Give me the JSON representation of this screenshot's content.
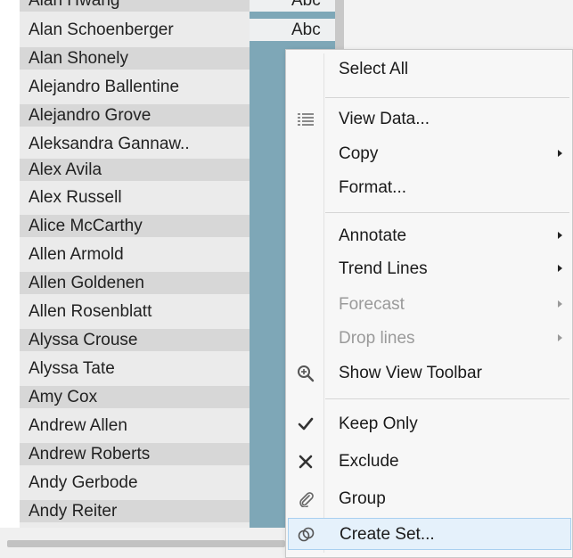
{
  "list": {
    "top_partial": "Alan Hwang",
    "names": [
      "Alan Schoenberger",
      "Alan Shonely",
      "Alejandro Ballentine",
      "Alejandro Grove",
      "Aleksandra Gannaw..",
      "Alex Avila",
      "Alex Russell",
      "Alice McCarthy",
      "Allen Armold",
      "Allen Goldenen",
      "Allen Rosenblatt",
      "Alyssa Crouse",
      "Alyssa Tate",
      "Amy Cox",
      "Andrew Allen",
      "Andrew Roberts",
      "Andy Gerbode",
      "Andy Reiter"
    ],
    "abc_top_partial": "Abc",
    "abc_value": "Abc"
  },
  "menu": {
    "items": [
      {
        "label": "Select All",
        "icon": "",
        "submenu": false,
        "disabled": false
      },
      {
        "label": "View Data...",
        "icon": "grid-icon",
        "submenu": false,
        "disabled": false
      },
      {
        "label": "Copy",
        "icon": "",
        "submenu": true,
        "disabled": false
      },
      {
        "label": "Format...",
        "icon": "",
        "submenu": false,
        "disabled": false
      },
      {
        "label": "Annotate",
        "icon": "",
        "submenu": true,
        "disabled": false
      },
      {
        "label": "Trend Lines",
        "icon": "",
        "submenu": true,
        "disabled": false
      },
      {
        "label": "Forecast",
        "icon": "",
        "submenu": true,
        "disabled": true
      },
      {
        "label": "Drop lines",
        "icon": "",
        "submenu": true,
        "disabled": true
      },
      {
        "label": "Show View Toolbar",
        "icon": "zoom-in-icon",
        "submenu": false,
        "disabled": false
      },
      {
        "label": "Keep Only",
        "icon": "check-icon",
        "submenu": false,
        "disabled": false
      },
      {
        "label": "Exclude",
        "icon": "x-icon",
        "submenu": false,
        "disabled": false
      },
      {
        "label": "Group",
        "icon": "paperclip-icon",
        "submenu": false,
        "disabled": false
      },
      {
        "label": "Create Set...",
        "icon": "venn-icon",
        "submenu": false,
        "disabled": false,
        "highlighted": true
      }
    ]
  },
  "colors": {
    "selected_column": "#7ea7b7",
    "menu_highlight": "#e5f1fb",
    "row_alt": "#d7d7d7"
  }
}
